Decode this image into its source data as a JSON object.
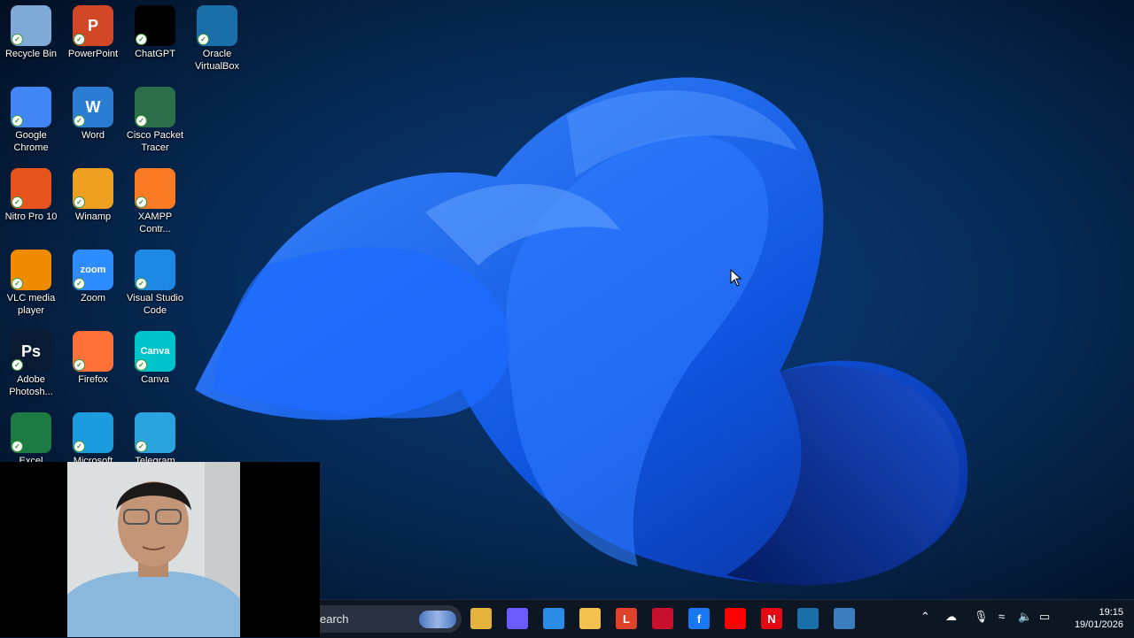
{
  "desktop": {
    "icons": [
      {
        "label": "Recycle Bin",
        "icon": "recycle-bin-icon",
        "color": "#7fa9d6"
      },
      {
        "label": "PowerPoint",
        "icon": "powerpoint-icon",
        "color": "#d24726",
        "glyph": "P"
      },
      {
        "label": "ChatGPT",
        "icon": "chatgpt-icon",
        "color": "#000000"
      },
      {
        "label": "Oracle VirtualBox",
        "icon": "virtualbox-icon",
        "color": "#1b6fa8"
      },
      {
        "label": "Google Chrome",
        "icon": "chrome-icon",
        "color": "#4285f4"
      },
      {
        "label": "Word",
        "icon": "word-icon",
        "color": "#2b7cd3",
        "glyph": "W"
      },
      {
        "label": "Cisco Packet Tracer",
        "icon": "packet-tracer-icon",
        "color": "#2c6e49"
      },
      {
        "label": "Nitro Pro 10",
        "icon": "nitro-icon",
        "color": "#e8541e"
      },
      {
        "label": "Winamp",
        "icon": "winamp-icon",
        "color": "#f0a020"
      },
      {
        "label": "XAMPP Contr...",
        "icon": "xampp-icon",
        "color": "#fb7a24"
      },
      {
        "label": "VLC media player",
        "icon": "vlc-icon",
        "color": "#f08a00"
      },
      {
        "label": "Zoom",
        "icon": "zoom-icon",
        "color": "#2d8cff",
        "glyph": "zoom"
      },
      {
        "label": "Visual Studio Code",
        "icon": "vscode-icon",
        "color": "#1e88e5"
      },
      {
        "label": "Adobe Photosh...",
        "icon": "photoshop-icon",
        "color": "#0a1a33",
        "glyph": "Ps"
      },
      {
        "label": "Firefox",
        "icon": "firefox-icon",
        "color": "#ff7139"
      },
      {
        "label": "Canva",
        "icon": "canva-icon",
        "color": "#00c4cc",
        "glyph": "Canva"
      },
      {
        "label": "Excel",
        "icon": "excel-icon",
        "color": "#1d7a43"
      },
      {
        "label": "Microsoft",
        "icon": "edge-icon",
        "color": "#1a9cde"
      },
      {
        "label": "Telegram",
        "icon": "telegram-icon",
        "color": "#2aa3df"
      }
    ]
  },
  "taskbar": {
    "search_text": "earch",
    "apps": [
      {
        "name": "file-explorer-icon",
        "color": "#e5b33b"
      },
      {
        "name": "copilot-icon",
        "color": "#6a5bff"
      },
      {
        "name": "store-icon",
        "color": "#2b8ce8"
      },
      {
        "name": "folder-icon",
        "color": "#f2c14e"
      },
      {
        "name": "l-app-icon",
        "color": "#e0432b",
        "glyph": "L"
      },
      {
        "name": "mcafee-icon",
        "color": "#c8102e"
      },
      {
        "name": "facebook-icon",
        "color": "#1877f2",
        "glyph": "f"
      },
      {
        "name": "youtube-icon",
        "color": "#ff0000"
      },
      {
        "name": "netflix-icon",
        "color": "#e50914",
        "glyph": "N"
      },
      {
        "name": "virtualbox-taskbar-icon",
        "color": "#1b6fa8"
      },
      {
        "name": "packet-tracer-taskbar-icon",
        "color": "#3b7dbf"
      }
    ],
    "time": "19:15",
    "date": "19/01/2026"
  }
}
